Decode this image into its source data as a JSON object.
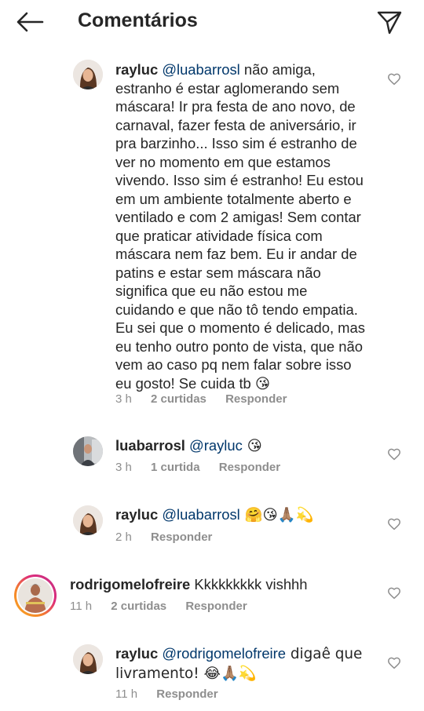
{
  "header": {
    "title": "Comentários"
  },
  "comments": [
    {
      "username": "rayluc",
      "mention": "@luabarrosl",
      "text": " não amiga, estranho é estar aglomerando sem máscara! Ir pra festa de ano novo, de carnaval, fazer festa de aniversário, ir pra barzinho... Isso sim é estranho de ver no momento em que estamos vivendo. Isso sim é estranho! Eu estou em um ambiente totalmente aberto e ventilado e com 2 amigas! Sem contar que praticar atividade física com máscara nem faz bem. Eu ir andar de patins e estar sem máscara não significa que eu não estou me cuidando e que não tô tendo empatia. Eu sei que o momento é delicado, mas eu tenho outro ponto de vista, que não vem ao caso pq nem falar sobre isso eu gosto! Se cuida tb 😘",
      "time": "3 h",
      "likes": "2 curtidas",
      "reply": "Responder"
    },
    {
      "username": "luabarrosl",
      "mention": "@rayluc",
      "text": " 😘",
      "time": "3 h",
      "likes": "1 curtida",
      "reply": "Responder"
    },
    {
      "username": "rayluc",
      "mention": "@luabarrosl",
      "text": " 🤗😘🙏🏽💫",
      "time": "2 h",
      "reply": "Responder"
    },
    {
      "username": "rodrigomelofreire",
      "text": " Kkkkkkkkk vishhh",
      "time": "11 h",
      "likes": "2 curtidas",
      "reply": "Responder"
    },
    {
      "username": "rayluc",
      "mention": "@rodrigomelofreire",
      "text": " digaê que livramento! 😂🙏🏽💫",
      "time": "11 h",
      "reply": "Responder"
    }
  ],
  "icons": {
    "back": "arrow-left-icon",
    "send": "paper-plane-icon",
    "like": "heart-outline-icon"
  },
  "colors": {
    "mention": "#00376b",
    "meta": "#8e8e8e",
    "text": "#262626"
  }
}
